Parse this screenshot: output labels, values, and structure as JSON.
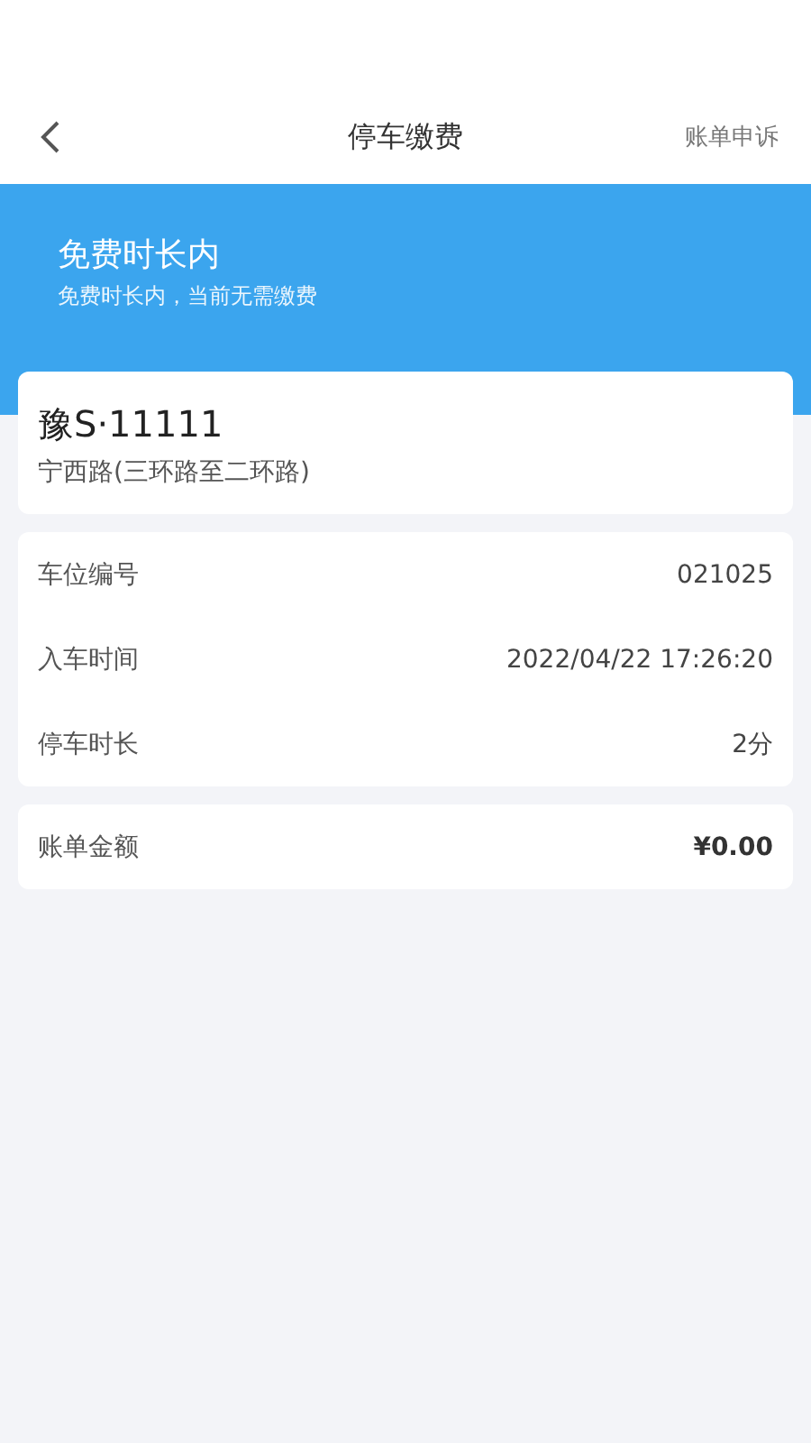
{
  "nav": {
    "title": "停车缴费",
    "action": "账单申诉"
  },
  "banner": {
    "title": "免费时长内",
    "subtitle": "免费时长内，当前无需缴费"
  },
  "vehicle": {
    "plate": "豫S·11111",
    "road": "宁西路(三环路至二环路)"
  },
  "details": [
    {
      "label": "车位编号",
      "value": "021025"
    },
    {
      "label": "入车时间",
      "value": "2022/04/22 17:26:20"
    },
    {
      "label": "停车时长",
      "value": "2分"
    }
  ],
  "bill": {
    "label": "账单金额",
    "value": "¥0.00"
  }
}
